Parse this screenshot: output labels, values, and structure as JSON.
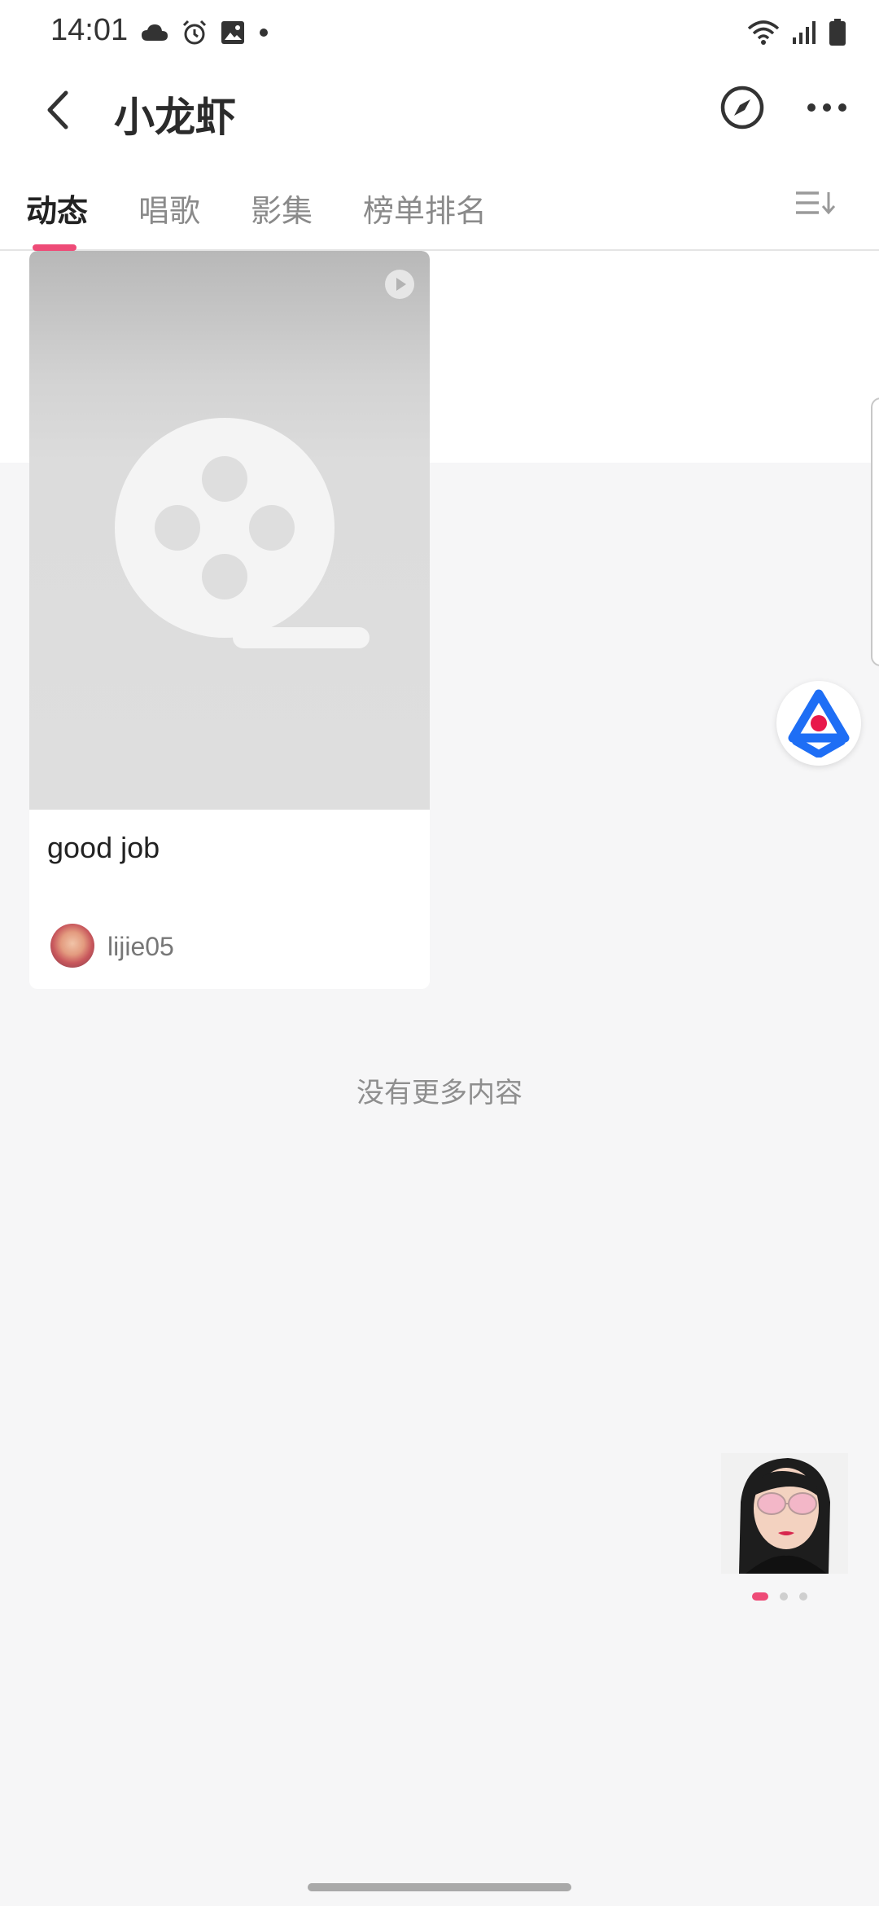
{
  "status_bar": {
    "time": "14:01",
    "left_icons": [
      "cloud-icon",
      "alarm-icon",
      "image-icon",
      "dot-icon"
    ],
    "right_icons": [
      "wifi-icon",
      "signal-icon",
      "battery-icon"
    ]
  },
  "header": {
    "title": "小龙虾",
    "icons": [
      "back-arrow-icon",
      "compass-icon",
      "more-dots-icon"
    ]
  },
  "tabs": [
    {
      "label": "动态",
      "active": true
    },
    {
      "label": "唱歌",
      "active": false
    },
    {
      "label": "影集",
      "active": false
    },
    {
      "label": "榜单排名",
      "active": false
    }
  ],
  "feed": {
    "items": [
      {
        "caption": "good job",
        "author": "lijie05",
        "media": "video"
      }
    ],
    "end_text": "没有更多内容"
  },
  "ad_banner": {
    "dots": 3,
    "active_dot": 0
  },
  "colors": {
    "accent": "#ee4b77",
    "background": "#f6f6f7",
    "assistant_blue": "#1e6ef5"
  }
}
